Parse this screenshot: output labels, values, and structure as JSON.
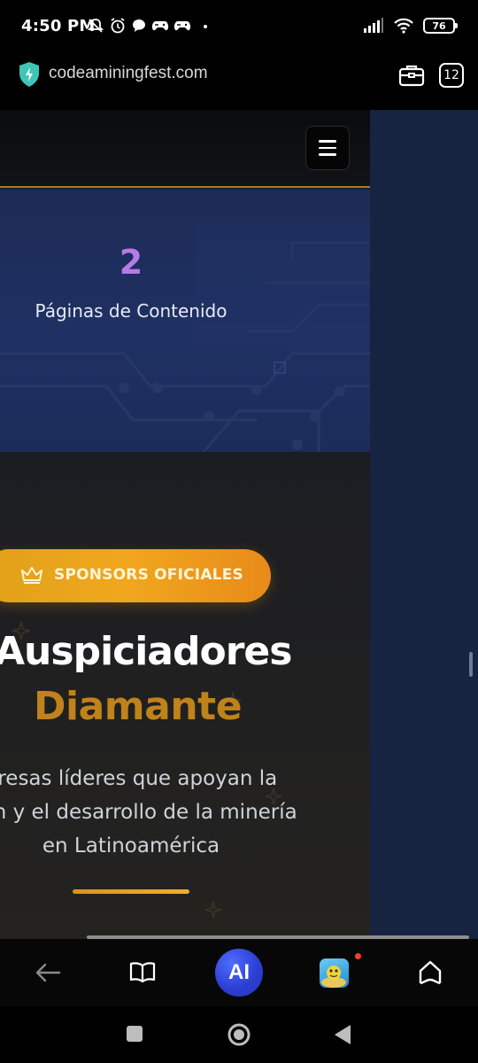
{
  "status_bar": {
    "time": "4:50 PM",
    "battery": "76"
  },
  "browser": {
    "url": "codeaminingfest.com",
    "tab_count": "12"
  },
  "site": {
    "stats": {
      "number": "2",
      "label": "Páginas de Contenido"
    },
    "sponsors": {
      "badge_label": "SPONSORS OFICIALES",
      "title_line1": "Auspiciadores",
      "title_line2": "Diamante",
      "description_lines": [
        "presas líderes que apoyan la",
        "sión y el desarrollo de la minería",
        "en Latinoamérica"
      ]
    }
  },
  "bottom_nav": {
    "ai_label": "AI"
  },
  "icons": [
    "muted-bell-icon",
    "alarm-icon",
    "chat-bubble-icon",
    "game-controller-icon",
    "signal-icon",
    "wifi-icon",
    "shield-icon",
    "toolbox-icon",
    "menu-icon",
    "crown-icon",
    "back-arrow-icon",
    "book-icon",
    "home-icon",
    "square-icon",
    "circle-icon",
    "triangle-back-icon"
  ],
  "colors": {
    "accent_gold": "#f1a71d",
    "title_gold": "#c0821b",
    "stat_purple": "#b57ce8",
    "stats_bg": "#1f3063",
    "ai_blue": "#2c3fd6"
  }
}
